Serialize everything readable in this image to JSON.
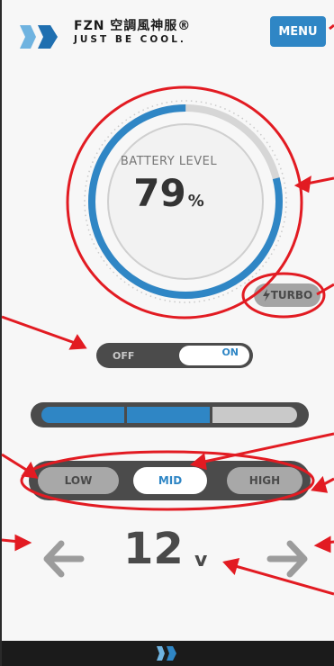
{
  "header": {
    "brand_name": "FZN 空調風神服®",
    "tagline": "JUST BE COOL.",
    "menu_label": "MENU",
    "accent": "#2f86c5"
  },
  "battery": {
    "label": "BATTERY LEVEL",
    "value": "79",
    "unit": "%",
    "level_percent": 79
  },
  "turbo": {
    "label": "TURBO",
    "icon": "bolt-icon"
  },
  "power_toggle": {
    "off_label": "OFF",
    "on_label": "ON",
    "state": "ON"
  },
  "level_bar": {
    "segments_filled": 2,
    "segments_total": 3,
    "fill_color": "#2f86c5",
    "empty_color": "#c9c9c9"
  },
  "fan_level": {
    "options": [
      "LOW",
      "MID",
      "HIGH"
    ],
    "selected": "MID"
  },
  "voltage": {
    "value": "12",
    "unit": "v",
    "prev_icon": "arrow-left-icon",
    "next_icon": "arrow-right-icon"
  },
  "annotation_color": "#e21b22"
}
